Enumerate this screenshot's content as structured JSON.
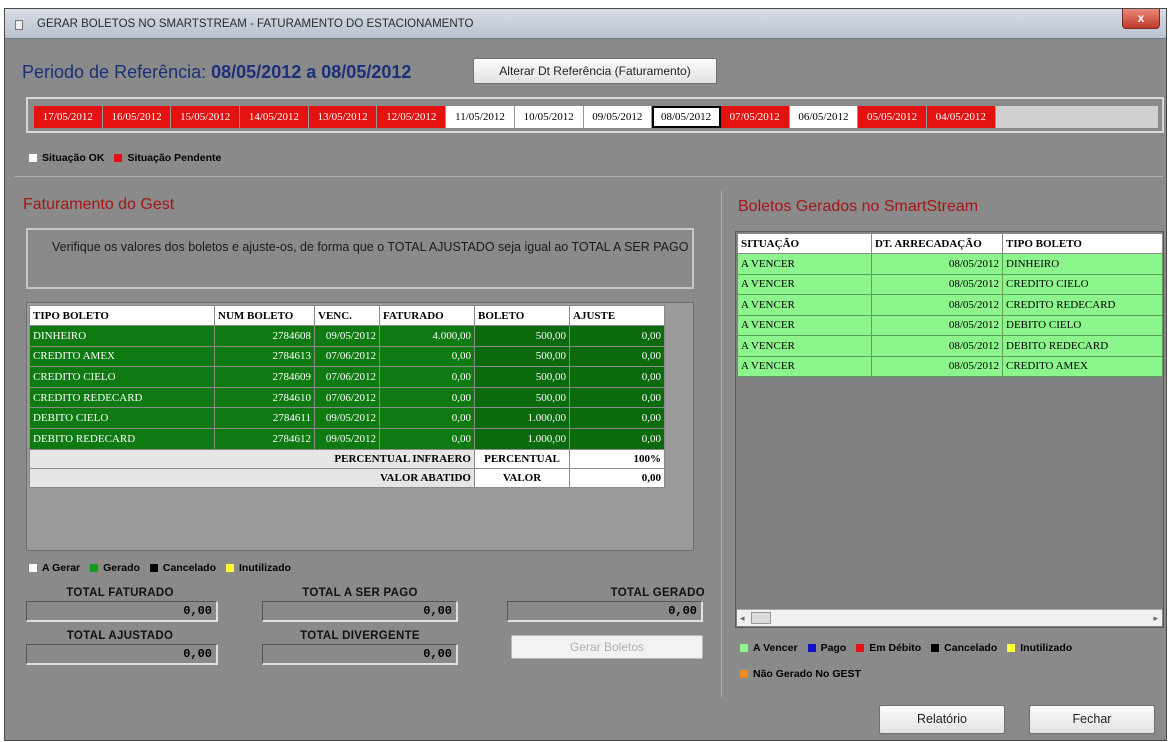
{
  "window": {
    "title": "GERAR BOLETOS NO SMARTSTREAM - FATURAMENTO DO ESTACIONAMENTO",
    "close_label": "x"
  },
  "period": {
    "label": "Periodo de Referência:",
    "start": "08/05/2012",
    "sep": "a",
    "end": "08/05/2012"
  },
  "alter_button": "Alterar Dt Referência (Faturamento)",
  "dates": [
    {
      "d": "17/05/2012",
      "s": "red"
    },
    {
      "d": "16/05/2012",
      "s": "red"
    },
    {
      "d": "15/05/2012",
      "s": "red"
    },
    {
      "d": "14/05/2012",
      "s": "red"
    },
    {
      "d": "13/05/2012",
      "s": "red"
    },
    {
      "d": "12/05/2012",
      "s": "red"
    },
    {
      "d": "11/05/2012",
      "s": "white"
    },
    {
      "d": "10/05/2012",
      "s": "white"
    },
    {
      "d": "09/05/2012",
      "s": "white"
    },
    {
      "d": "08/05/2012",
      "s": "white sel"
    },
    {
      "d": "07/05/2012",
      "s": "red"
    },
    {
      "d": "06/05/2012",
      "s": "white"
    },
    {
      "d": "05/05/2012",
      "s": "red"
    },
    {
      "d": "04/05/2012",
      "s": "red"
    }
  ],
  "legend_top": {
    "ok": "Situação OK",
    "pending": "Situação Pendente"
  },
  "gest": {
    "title": "Faturamento do Gest",
    "info": "Verifique os valores dos boletos e ajuste-os, de forma que o TOTAL AJUSTADO seja igual ao TOTAL A SER PAGO",
    "columns": [
      "TIPO BOLETO",
      "NUM BOLETO",
      "VENC.",
      "FATURADO",
      "BOLETO",
      "AJUSTE"
    ],
    "rows": [
      [
        "DINHEIRO",
        "2784608",
        "09/05/2012",
        "4.000,00",
        "500,00",
        "0,00"
      ],
      [
        "CREDITO AMEX",
        "2784613",
        "07/06/2012",
        "0,00",
        "500,00",
        "0,00"
      ],
      [
        "CREDITO CIELO",
        "2784609",
        "07/06/2012",
        "0,00",
        "500,00",
        "0,00"
      ],
      [
        "CREDITO REDECARD",
        "2784610",
        "07/06/2012",
        "0,00",
        "500,00",
        "0,00"
      ],
      [
        "DEBITO CIELO",
        "2784611",
        "09/05/2012",
        "0,00",
        "1.000,00",
        "0,00"
      ],
      [
        "DEBITO REDECARD",
        "2784612",
        "09/05/2012",
        "0,00",
        "1.000,00",
        "0,00"
      ]
    ],
    "perc_label": "PERCENTUAL INFRAERO",
    "perc_key": "PERCENTUAL",
    "perc_value": "100%",
    "abat_label": "VALOR ABATIDO",
    "abat_key": "VALOR",
    "abat_value": "0,00"
  },
  "legend_mid": {
    "a_gerar": "A Gerar",
    "gerado": "Gerado",
    "cancelado": "Cancelado",
    "inutilizado": "Inutilizado"
  },
  "totals": {
    "faturado_label": "TOTAL FATURADO",
    "faturado": "0,00",
    "a_ser_pago_label": "TOTAL A SER PAGO",
    "a_ser_pago": "0,00",
    "gerado_label": "TOTAL GERADO",
    "gerado": "0,00",
    "ajustado_label": "TOTAL AJUSTADO",
    "ajustado": "0,00",
    "divergente_label": "TOTAL DIVERGENTE",
    "divergente": "0,00"
  },
  "gerar_button": "Gerar Boletos",
  "smart": {
    "title": "Boletos Gerados no SmartStream",
    "columns": [
      "SITUAÇÃO",
      "DT. ARRECADAÇÃO",
      "TIPO BOLETO"
    ],
    "rows": [
      [
        "A VENCER",
        "08/05/2012",
        "DINHEIRO"
      ],
      [
        "A VENCER",
        "08/05/2012",
        "CREDITO CIELO"
      ],
      [
        "A VENCER",
        "08/05/2012",
        "CREDITO REDECARD"
      ],
      [
        "A VENCER",
        "08/05/2012",
        "DEBITO CIELO"
      ],
      [
        "A VENCER",
        "08/05/2012",
        "DEBITO REDECARD"
      ],
      [
        "A VENCER",
        "08/05/2012",
        "CREDITO AMEX"
      ]
    ]
  },
  "legend_right": {
    "a_vencer": "A Vencer",
    "pago": "Pago",
    "em_debito": "Em Débito",
    "cancelado": "Cancelado",
    "inutilizado": "Inutilizado",
    "nao_gerado": "Não Gerado No GEST"
  },
  "colors": {
    "ok": "#ffffff",
    "pending": "#e3110f",
    "gerado": "#12a012",
    "cancelado": "#000000",
    "inutilizado": "#ffff33",
    "a_vencer": "#8cf58c",
    "pago": "#1010c8",
    "em_debito": "#e3110f",
    "nao_gerado": "#f08a1c"
  },
  "footer": {
    "relatorio": "Relatório",
    "fechar": "Fechar"
  }
}
